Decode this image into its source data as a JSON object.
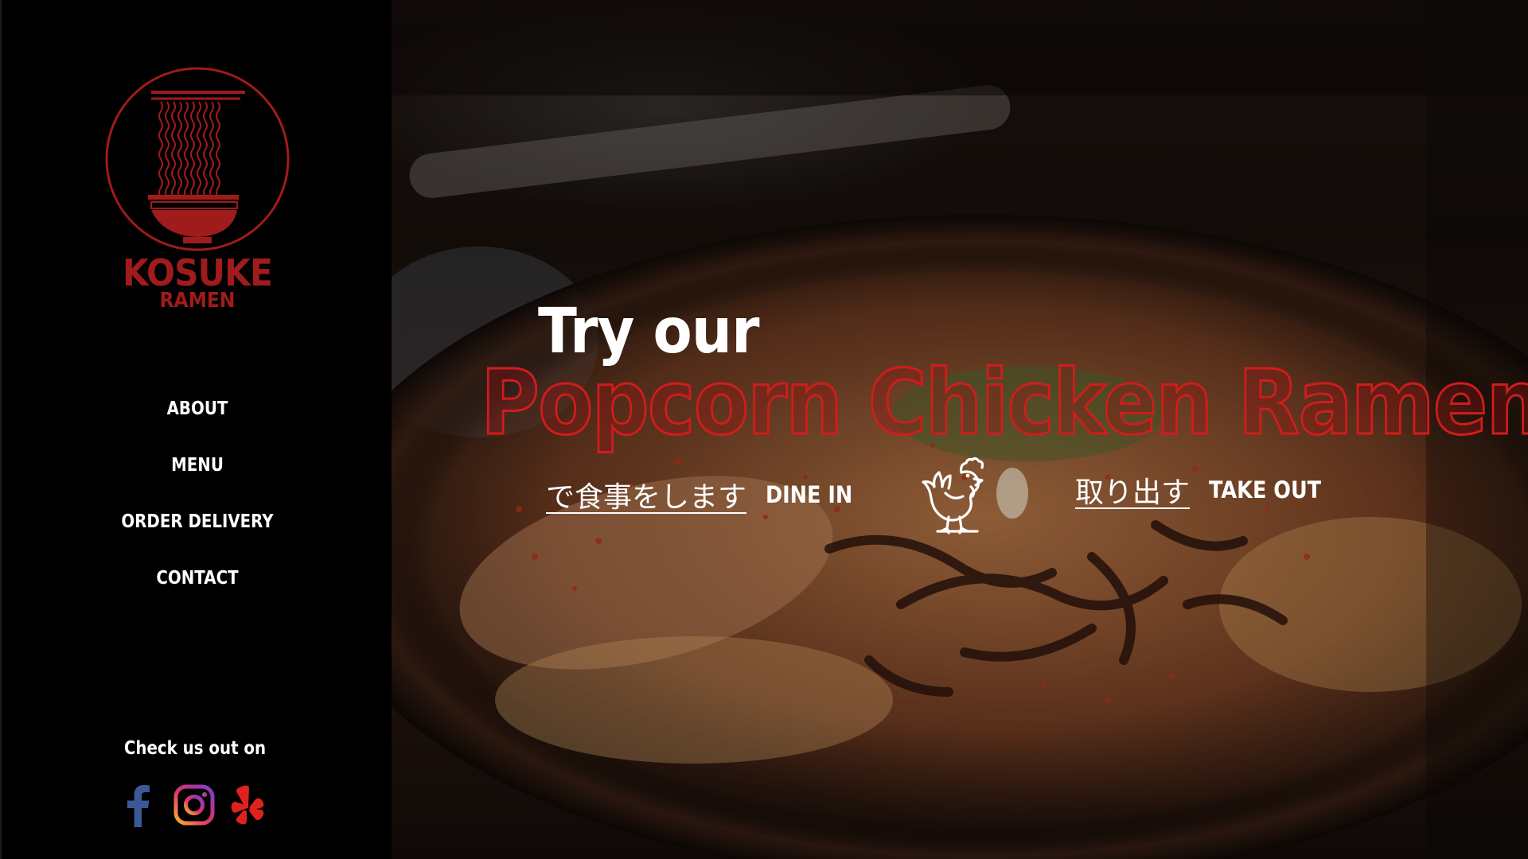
{
  "brand": {
    "name": "KOSUKE",
    "sub": "RAMEN",
    "logo_icon": "ramen-bowl-chopsticks-icon",
    "color": "#a01b1b"
  },
  "nav": {
    "items": [
      {
        "label": "ABOUT"
      },
      {
        "label": "MENU"
      },
      {
        "label": "ORDER DELIVERY"
      },
      {
        "label": "CONTACT"
      }
    ]
  },
  "social": {
    "label": "Check us out on",
    "icons": [
      "facebook-icon",
      "instagram-icon",
      "yelp-icon"
    ]
  },
  "hero": {
    "intro": "Try our",
    "headline": "Popcorn Chicken Ramen",
    "headline_color": "#d21c1c",
    "dine_in": {
      "jp": "で食事をします",
      "en": "DINE IN"
    },
    "take_out": {
      "jp": "取り出す",
      "en": "TAKE OUT"
    },
    "divider_icon": "rooster-icon"
  }
}
